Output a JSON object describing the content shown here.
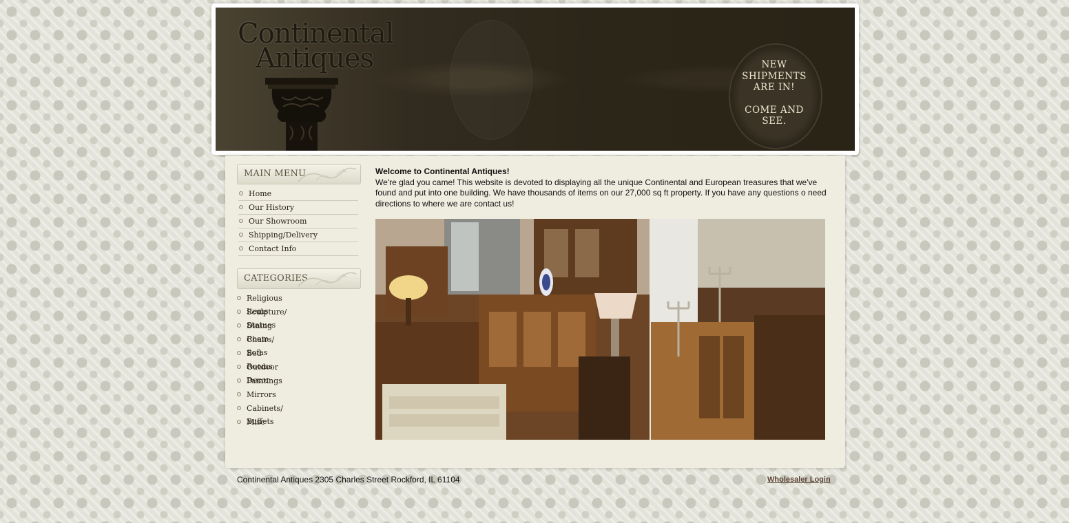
{
  "header": {
    "logo_line1": "Continental",
    "logo_line2": "Antiques",
    "promo": {
      "line1": "NEW",
      "line2": "SHIPMENTS",
      "line3": "ARE IN!",
      "line4": "COME AND",
      "line5": "SEE."
    }
  },
  "sidebar": {
    "main_menu": {
      "title": "MAIN MENU",
      "items": [
        {
          "label": "Home"
        },
        {
          "label": "Our History"
        },
        {
          "label": "Our Showroom"
        },
        {
          "label": "Shipping/Delivery"
        },
        {
          "label": "Contact Info"
        }
      ]
    },
    "categories": {
      "title": "CATEGORIES",
      "items": [
        {
          "label": "Religious Items"
        },
        {
          "label": "Sculpture/ Statues"
        },
        {
          "label": "Dining Room"
        },
        {
          "label": "Chairs/ Sofas"
        },
        {
          "label": "Bed Rooms"
        },
        {
          "label": "Outdoor Decor"
        },
        {
          "label": "Paintings"
        },
        {
          "label": "Mirrors"
        },
        {
          "label": "Cabinets/ Buffets"
        },
        {
          "label": "Misc"
        }
      ]
    }
  },
  "main": {
    "welcome_title": "Welcome to Continental Antiques!",
    "welcome_body": "We're glad you came! This website is devoted to displaying all the unique Continental and European treasures that we've found and put into one building. We have thousands of items on our 27,000 sq ft property. If you have any questions o need directions to where we are contact us!"
  },
  "footer": {
    "address": "Continental Antiques 2305 Charles Street Rockford, IL 61104",
    "login_label": "Wholesaler Login"
  },
  "colors": {
    "background": "#e3e3da",
    "panel": "#efede0",
    "banner": "#2c2619",
    "login_link": "#5b4335"
  }
}
